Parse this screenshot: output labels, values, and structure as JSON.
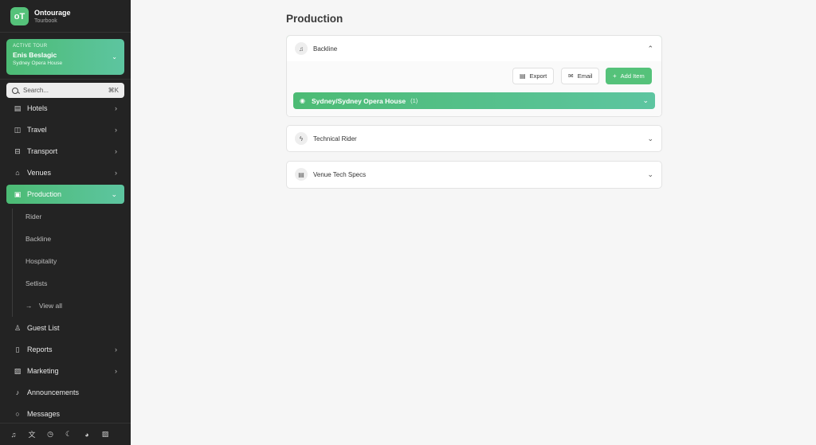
{
  "brand": {
    "name": "Ontourage",
    "subtitle": "Tourbook",
    "logo_text": "oT"
  },
  "active_tour": {
    "label": "ACTIVE TOUR",
    "name": "Enis Beslagic",
    "venue": "Sydney Opera House"
  },
  "search": {
    "placeholder": "Search...",
    "shortcut": "⌘K"
  },
  "nav": {
    "hotels": "Hotels",
    "travel": "Travel",
    "transport": "Transport",
    "venues": "Venues",
    "production": "Production",
    "guest_list": "Guest List",
    "reports": "Reports",
    "marketing": "Marketing",
    "announcements": "Announcements",
    "messages": "Messages"
  },
  "production_sub": {
    "rider": "Rider",
    "backline": "Backline",
    "hospitality": "Hospitality",
    "setlists": "Setlists",
    "view_all": "View all"
  },
  "bottom_icons": [
    "bell-icon",
    "translate-icon",
    "clock-icon",
    "moon-icon",
    "palette-icon",
    "image-icon"
  ],
  "main": {
    "page_title": "Production",
    "panels": {
      "backline": "Backline",
      "technical_rider": "Technical Rider",
      "venue_tech_specs": "Venue Tech Specs"
    },
    "actions": {
      "export": "Export",
      "email": "Email",
      "add_item": "Add Item"
    },
    "location": {
      "name": "Sydney/Sydney Opera House",
      "count": "(1)"
    }
  },
  "colors": {
    "accent": "#55c27a",
    "sidebar_bg": "#232323",
    "main_bg": "#f6f6f6"
  }
}
